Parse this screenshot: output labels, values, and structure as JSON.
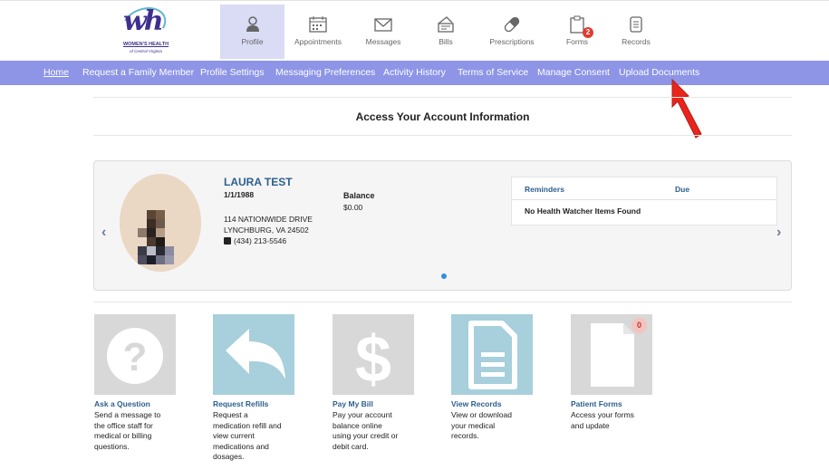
{
  "brand": {
    "logo_mark": "wh",
    "logo_name": "WOMEN'S HEALTH",
    "logo_sub": "of Central Virginia"
  },
  "topnav": [
    {
      "label": "Profile",
      "icon": "user-icon",
      "active": true
    },
    {
      "label": "Appointments",
      "icon": "calendar-icon"
    },
    {
      "label": "Messages",
      "icon": "envelope-icon"
    },
    {
      "label": "Bills",
      "icon": "wallet-icon"
    },
    {
      "label": "Prescriptions",
      "icon": "pill-icon"
    },
    {
      "label": "Forms",
      "icon": "clipboard-icon",
      "badge": "2"
    },
    {
      "label": "Records",
      "icon": "document-icon"
    }
  ],
  "subnav": [
    "Home",
    "Request a Family Member",
    "Profile Settings",
    "Messaging Preferences",
    "Activity History",
    "Terms of Service",
    "Manage Consent",
    "Upload Documents"
  ],
  "page_title": "Access Your Account Information",
  "patient": {
    "name": "LAURA TEST",
    "dob": "1/1/1988",
    "address1": "114 NATIONWIDE DRIVE",
    "address2": "LYNCHBURG, VA 24502",
    "phone": "(434) 213-5546",
    "balance_label": "Balance",
    "balance": "$0.00"
  },
  "reminders": {
    "col1": "Reminders",
    "col2": "Due",
    "empty": "No Health Watcher Items Found"
  },
  "tiles": [
    {
      "label": "Ask a Question",
      "desc": [
        "Send a message to",
        "the office staff for",
        "medical or billing",
        "questions."
      ],
      "icon": "question-icon",
      "color": "#d8d8d8"
    },
    {
      "label": "Request Refills",
      "desc": [
        "Request a",
        "medication refill and",
        "view current",
        "medications and",
        "dosages."
      ],
      "icon": "reply-arrow-icon",
      "color": "#a7cfdc"
    },
    {
      "label": "Pay My Bill",
      "desc": [
        "Pay your account",
        "balance online",
        "using your credit or",
        "debit card."
      ],
      "icon": "dollar-icon",
      "color": "#d8d8d8"
    },
    {
      "label": "View Records",
      "desc": [
        "View or download",
        "your medical",
        "records."
      ],
      "icon": "document-icon",
      "color": "#a7cfdc"
    },
    {
      "label": "Patient Forms",
      "desc": [
        "Access your forms",
        "and update"
      ],
      "icon": "blank-page-icon",
      "color": "#d8d8d8",
      "badge": "0"
    }
  ],
  "colors": {
    "subnav_bg": "#8e95e6",
    "active_tab": "#d9dcf4",
    "link_blue": "#2d5f8f",
    "annotation_arrow": "#e8261c"
  }
}
